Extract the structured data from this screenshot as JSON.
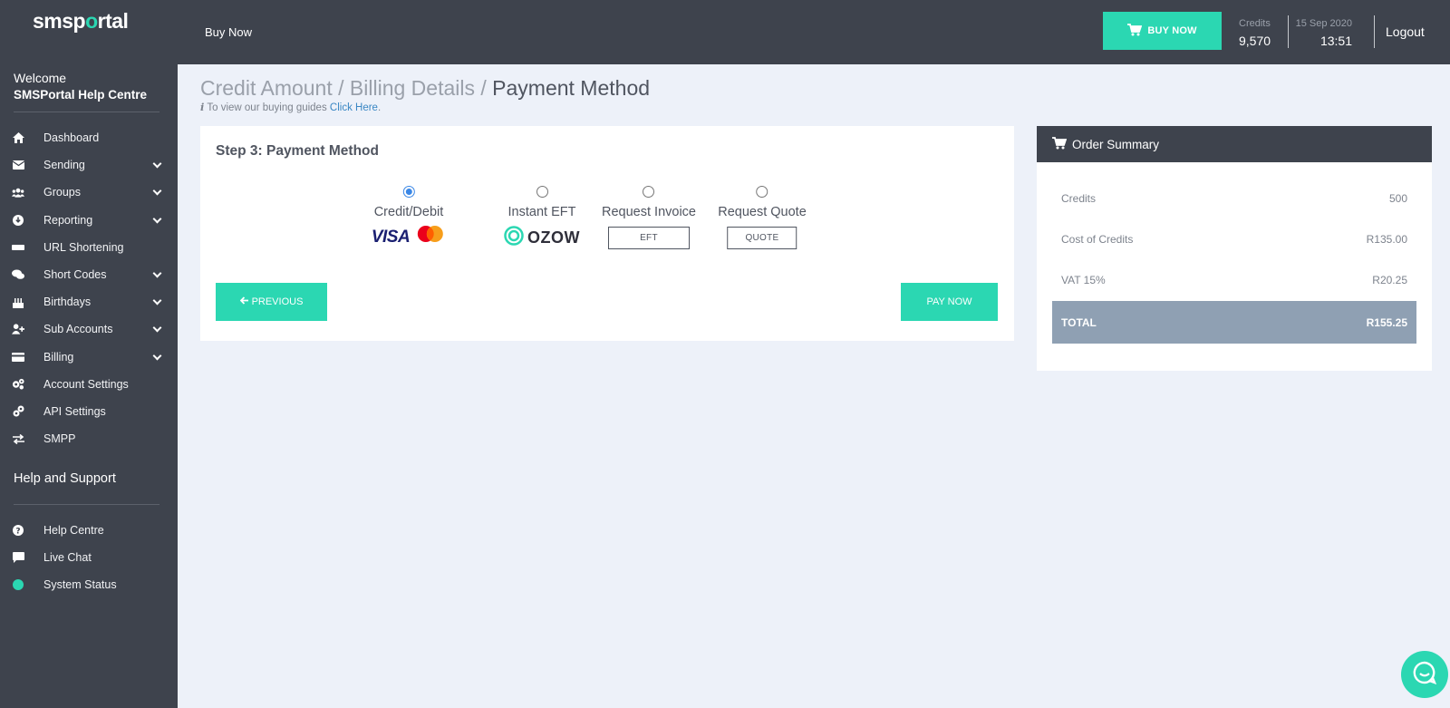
{
  "sidebar": {
    "logo_left": "sms",
    "logo_o": "o",
    "logo_right": "rtal",
    "logo_pre": "smsp",
    "welcome": "Welcome",
    "username": "SMSPortal Help Centre",
    "nav": [
      {
        "label": "Dashboard",
        "icon": "home-icon",
        "chevron": false
      },
      {
        "label": "Sending",
        "icon": "envelope-icon",
        "chevron": true
      },
      {
        "label": "Groups",
        "icon": "users-icon",
        "chevron": true
      },
      {
        "label": "Reporting",
        "icon": "download-icon",
        "chevron": true
      },
      {
        "label": "URL Shortening",
        "icon": "link-bar-icon",
        "chevron": false
      },
      {
        "label": "Short Codes",
        "icon": "comments-icon",
        "chevron": true
      },
      {
        "label": "Birthdays",
        "icon": "cake-icon",
        "chevron": true
      },
      {
        "label": "Sub Accounts",
        "icon": "user-plus-icon",
        "chevron": true
      },
      {
        "label": "Billing",
        "icon": "credit-card-icon",
        "chevron": true
      },
      {
        "label": "Account Settings",
        "icon": "cogs-icon",
        "chevron": false
      },
      {
        "label": "API Settings",
        "icon": "plug-icon",
        "chevron": false
      },
      {
        "label": "SMPP",
        "icon": "exchange-icon",
        "chevron": false
      }
    ],
    "help_title": "Help and Support",
    "help_nav": [
      {
        "label": "Help Centre",
        "icon": "question-icon"
      },
      {
        "label": "Live Chat",
        "icon": "chat-icon"
      },
      {
        "label": "System Status",
        "icon": "status-dot-icon"
      }
    ]
  },
  "topbar": {
    "buy_now_link": "Buy Now",
    "buy_now_button": "BUY NOW",
    "credits_label": "Credits",
    "credits_value": "9,570",
    "date": "15 Sep 2020",
    "time": "13:51",
    "logout": "Logout"
  },
  "breadcrumb": {
    "step1": "Credit Amount",
    "sep": " / ",
    "step2": "Billing Details",
    "current": "Payment Method",
    "guide_text": "To view our buying guides ",
    "guide_link": "Click Here",
    "guide_end": "."
  },
  "payment": {
    "title": "Step 3: Payment Method",
    "methods": [
      {
        "label": "Credit/Debit",
        "selected": true,
        "logo_text": "VISA"
      },
      {
        "label": "Instant EFT",
        "selected": false,
        "logo_text": "OZOW"
      },
      {
        "label": "Request Invoice",
        "selected": false,
        "button": "EFT"
      },
      {
        "label": "Request Quote",
        "selected": false,
        "button": "QUOTE"
      }
    ],
    "previous": "PREVIOUS",
    "pay_now": "PAY NOW"
  },
  "summary": {
    "title": "Order Summary",
    "rows": [
      {
        "label": "Credits",
        "value": "500"
      },
      {
        "label": "Cost of Credits",
        "value": "R135.00"
      },
      {
        "label": "VAT 15%",
        "value": "R20.25"
      }
    ],
    "total_label": "TOTAL",
    "total_value": "R155.25"
  },
  "colors": {
    "accent": "#2bd7b2",
    "sidebar": "#3e434d",
    "status_ok": "#2bd7b2"
  }
}
